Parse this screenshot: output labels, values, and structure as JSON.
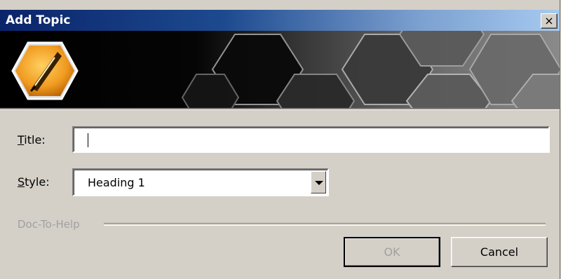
{
  "window": {
    "title": "Add Topic",
    "close_glyph": "×"
  },
  "banner": {
    "icon": "pen-nib-hexagon-logo"
  },
  "form": {
    "title_label_prefix": "",
    "title_label_mnemonic": "T",
    "title_label_rest": "itle:",
    "title_value": "",
    "style_label_mnemonic": "S",
    "style_label_rest": "tyle:",
    "style_value": "Heading 1"
  },
  "group": {
    "label": "Doc-To-Help"
  },
  "buttons": {
    "ok": "OK",
    "cancel": "Cancel"
  },
  "colors": {
    "titlebar_start": "#0a246a",
    "titlebar_end": "#a6caf0",
    "dialog_bg": "#d4d0c8",
    "logo_orange": "#f0a020"
  }
}
